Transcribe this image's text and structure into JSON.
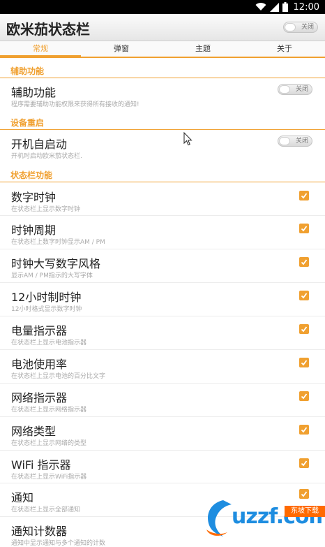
{
  "status_bar": {
    "time": "12:00"
  },
  "app": {
    "title": "欧米茄状态栏",
    "header_toggle_label": "关闭"
  },
  "tabs": [
    {
      "label": "常规",
      "active": true
    },
    {
      "label": "弹窗",
      "active": false
    },
    {
      "label": "主题",
      "active": false
    },
    {
      "label": "关于",
      "active": false
    }
  ],
  "sections": {
    "accessibility": {
      "header": "辅助功能",
      "item_title": "辅助功能",
      "item_subtitle": "程序需要辅助功能权限来获得所有接收的通知!",
      "toggle_label": "关闭"
    },
    "reboot": {
      "header": "设备重启",
      "item_title": "开机自启动",
      "item_subtitle": "开机时启动欧米茄状态栏.",
      "toggle_label": "关闭"
    },
    "statusbar_features": {
      "header": "状态栏功能",
      "items": [
        {
          "title": "数字时钟",
          "subtitle": "在状态栏上显示数字时钟",
          "checked": true
        },
        {
          "title": "时钟周期",
          "subtitle": "在状态栏上数字时钟显示AM / PM",
          "checked": true
        },
        {
          "title": "时钟大写数字风格",
          "subtitle": "显示AM / PM指示的大写字体",
          "checked": true
        },
        {
          "title": "12小时制时钟",
          "subtitle": "12小时格式显示数字时钟",
          "checked": true
        },
        {
          "title": "电量指示器",
          "subtitle": "在状态栏上显示电池指示器",
          "checked": true
        },
        {
          "title": "电池使用率",
          "subtitle": "在状态栏上显示电池的百分比文字",
          "checked": true
        },
        {
          "title": "网络指示器",
          "subtitle": "在状态栏上显示网络指示器",
          "checked": true
        },
        {
          "title": "网络类型",
          "subtitle": "在状态栏上显示网络的类型",
          "checked": true
        },
        {
          "title": "WiFi 指示器",
          "subtitle": "在状态栏上显示WiFi指示器",
          "checked": true
        },
        {
          "title": "通知",
          "subtitle": "在状态栏上显示全部通知",
          "checked": true
        },
        {
          "title": "通知计数器",
          "subtitle": "通知中显示通知与多个通知的计数",
          "checked": true
        }
      ]
    }
  },
  "watermark": {
    "text": "uzzf.com",
    "tag": "东坡下载"
  },
  "colors": {
    "accent": "#f0a030",
    "logo_blue": "#1e8de0",
    "logo_orange": "#ff6a00"
  }
}
